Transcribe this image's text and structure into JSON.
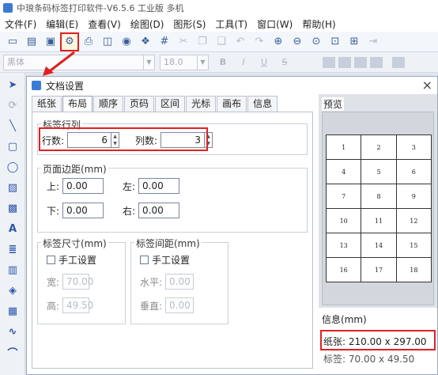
{
  "window": {
    "title": "中琅条码标签打印软件-V6.5.6 工业版 多机"
  },
  "menu": [
    "文件(F)",
    "编辑(E)",
    "查看(V)",
    "绘图(D)",
    "图形(S)",
    "工具(T)",
    "窗口(W)",
    "帮助(H)"
  ],
  "toolbar": {
    "icons": [
      "new-icon",
      "open-icon",
      "save-icon",
      "document-settings-icon",
      "print-icon",
      "print-preview-icon",
      "database-icon",
      "batch-icon",
      "grid-icon",
      "cut-icon",
      "copy-icon",
      "paste-icon",
      "undo-icon",
      "redo-icon",
      "zoom-in-icon",
      "zoom-out-icon",
      "zoom-fit-icon",
      "actual-size-icon",
      "fit-page-icon",
      "more-icon"
    ],
    "highlighted": "document-settings-icon"
  },
  "fontbar": {
    "font": "黑体",
    "size": "18.0",
    "bold": "B",
    "italic": "I",
    "underline": "U",
    "strike": "S"
  },
  "leftbar": {
    "icons": [
      "pointer-icon",
      "rotate-icon",
      "line-icon",
      "rectangle-icon",
      "ellipse-icon",
      "image-icon",
      "picture-icon",
      "text-icon",
      "paragraph-icon",
      "barcode-icon",
      "qrcode-icon",
      "data-matrix-icon",
      "curve-icon",
      "arc-icon",
      "polyline-icon"
    ],
    "text_glyph": "A"
  },
  "dialog": {
    "title": "文档设置",
    "close": "×",
    "tabs": [
      "纸张",
      "布局",
      "顺序",
      "页码",
      "区间",
      "光标",
      "画布",
      "信息"
    ],
    "active_tab": "布局",
    "rows_cols": {
      "legend": "标签行列",
      "rows_label": "行数:",
      "rows": "6",
      "cols_label": "列数:",
      "cols": "3"
    },
    "margins": {
      "legend": "页面边距(mm)",
      "top_label": "上:",
      "top": "0.00",
      "left_label": "左:",
      "left": "0.00",
      "bottom_label": "下:",
      "bottom": "0.00",
      "right_label": "右:",
      "right": "0.00"
    },
    "label_size": {
      "legend": "标签尺寸(mm)",
      "manual": "手工设置",
      "width_label": "宽:",
      "width": "70.00",
      "height_label": "高:",
      "height": "49.50"
    },
    "label_gap": {
      "legend": "标签间距(mm)",
      "manual": "手工设置",
      "h_label": "水平:",
      "h": "0.00",
      "v_label": "垂直:",
      "v": "0.00"
    },
    "preview": {
      "legend": "预览",
      "cells": [
        [
          "1",
          "2",
          "3"
        ],
        [
          "4",
          "5",
          "6"
        ],
        [
          "7",
          "8",
          "9"
        ],
        [
          "10",
          "11",
          "12"
        ],
        [
          "13",
          "14",
          "15"
        ],
        [
          "16",
          "17",
          "18"
        ]
      ]
    },
    "info": {
      "legend": "信息(mm)",
      "paper": "纸张: 210.00 x 297.00",
      "label": "标签: 70.00 x 49.50"
    }
  }
}
